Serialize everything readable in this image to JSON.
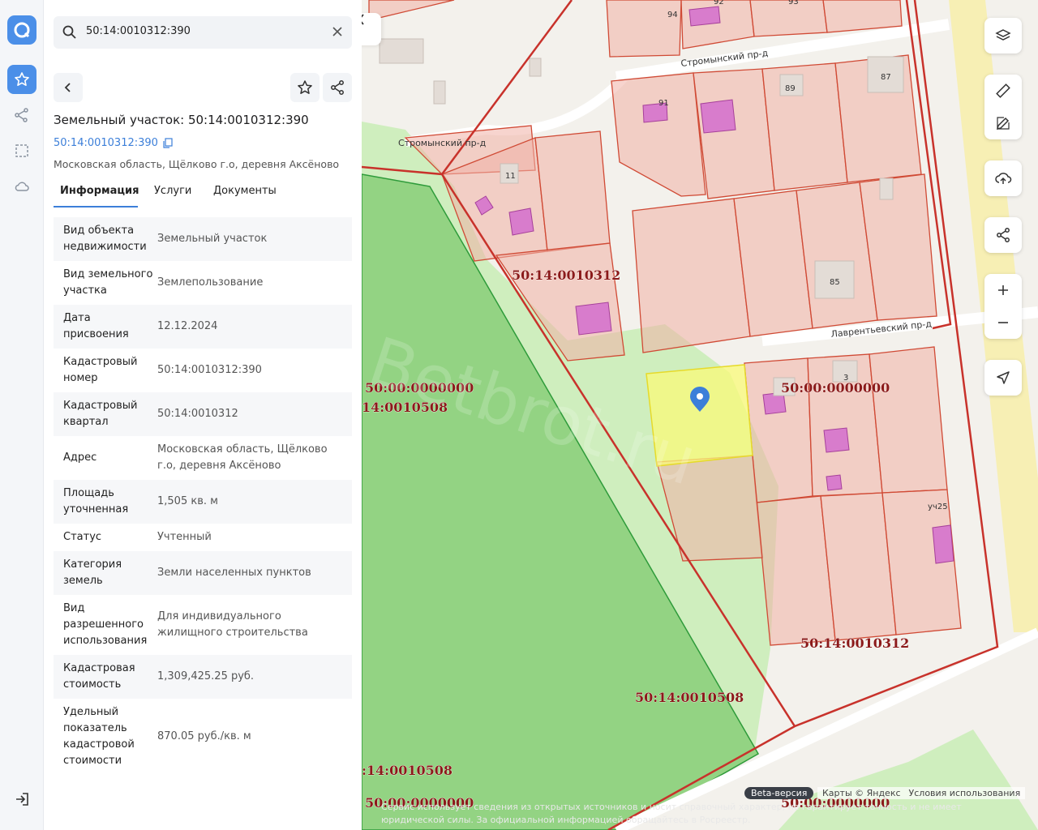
{
  "search": {
    "value": "50:14:0010312:390"
  },
  "panel": {
    "title": "Земельный участок: 50:14:0010312:390",
    "cadastral_link": "50:14:0010312:390",
    "address": "Московская область, Щёлково г.о, деревня Аксёново",
    "tabs": [
      "Информация",
      "Услуги",
      "Документы"
    ],
    "rows": [
      {
        "label": "Вид объекта недвижимости",
        "value": "Земельный участок"
      },
      {
        "label": "Вид земельного участка",
        "value": "Землепользование"
      },
      {
        "label": "Дата присвоения",
        "value": "12.12.2024"
      },
      {
        "label": "Кадастровый номер",
        "value": "50:14:0010312:390"
      },
      {
        "label": "Кадастровый квартал",
        "value": "50:14:0010312"
      },
      {
        "label": "Адрес",
        "value": "Московская область, Щёлково г.о, деревня Аксёново"
      },
      {
        "label": "Площадь уточненная",
        "value": "1,505 кв. м"
      },
      {
        "label": "Статус",
        "value": "Учтенный"
      },
      {
        "label": "Категория земель",
        "value": "Земли населенных пунктов"
      },
      {
        "label": "Вид разрешенного использования",
        "value": "Для индивидуального жилищного строительства"
      },
      {
        "label": "Кадастровая стоимость",
        "value": "1,309,425.25 руб."
      },
      {
        "label": "Удельный показатель кадастровой стоимости",
        "value": "870.05 руб./кв. м"
      }
    ]
  },
  "map": {
    "streets": [
      "Стромынский пр-д",
      "Стромынский пр-д",
      "Лаврентьевский пр-д"
    ],
    "house_numbers": [
      "94",
      "92",
      "93",
      "91",
      "89",
      "87",
      "11",
      "85",
      "3",
      "уч25"
    ],
    "quarter_labels": [
      "50:14:0010312",
      "50:00:0000000",
      "14:0010508",
      "50:00:0000000",
      "50:14:0010312",
      "50:14:0010508",
      ":14:0010508",
      "50:00:0000000",
      "50:00:0000000"
    ],
    "beta": "Beta-версия",
    "attribution": "Карты © Яндекс",
    "terms": "Условия использования",
    "disclaimer": "Сервис использует сведения из открытых источников и носит справочный характер, не гарантирует точность и не имеет юридической силы. За официальной информацией обращайтесь в Росреестр.",
    "watermark": "Betbrot.ru"
  },
  "colors": {
    "accent": "#4b8fe8",
    "parcel_stroke": "#d04a35",
    "quarter_label": "#8b1a1a"
  }
}
